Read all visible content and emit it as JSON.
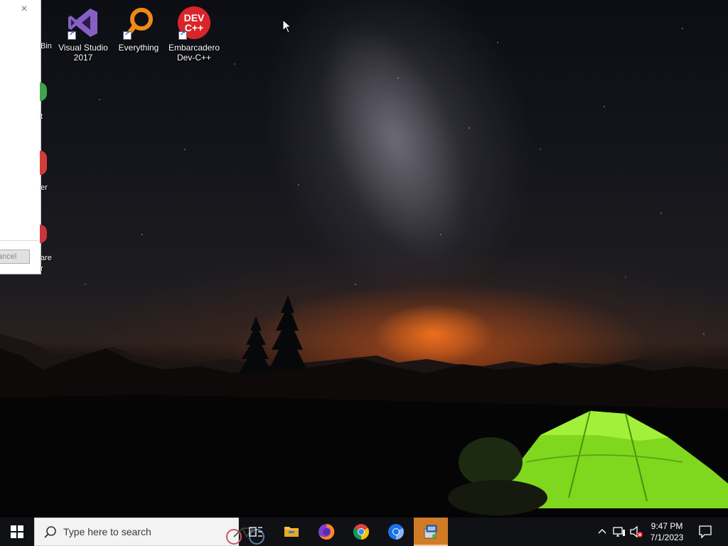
{
  "desktop": {
    "icons": [
      {
        "label_line1": "Visual Studio",
        "label_line2": "2017",
        "accent": "#865fc5"
      },
      {
        "label_line1": "Everything",
        "label_line2": "",
        "accent": "#f08a14"
      },
      {
        "label_line1": "Embarcadero",
        "label_line2": "Dev-C++",
        "accent": "#d9252a",
        "glyph_text_top": "DEV",
        "glyph_text_bottom": "C++"
      }
    ],
    "peek_labels": [
      "Bin",
      "t",
      "er",
      "are",
      "r"
    ]
  },
  "dialog": {
    "close_glyph": "×",
    "cancel_label": "ancel"
  },
  "taskbar": {
    "search_placeholder": "Type here to search",
    "pinned": [
      {
        "name": "task-view",
        "icon": "task-view-icon"
      },
      {
        "name": "file-explorer",
        "icon": "folder-icon"
      },
      {
        "name": "firefox",
        "icon": "firefox-icon"
      },
      {
        "name": "chrome",
        "icon": "chrome-icon"
      },
      {
        "name": "chrome-beta",
        "icon": "chrome-beta-icon"
      },
      {
        "name": "installer",
        "icon": "installer-icon",
        "active": true
      }
    ],
    "clock": {
      "time": "9:47 PM",
      "date": "7/1/2023"
    },
    "accent_active": "#d27b26"
  }
}
